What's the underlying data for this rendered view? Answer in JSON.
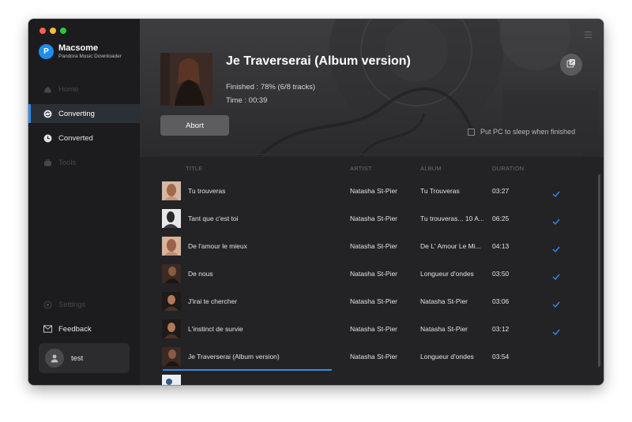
{
  "app": {
    "name": "Macsome",
    "subtitle": "Pandora Music Downloader"
  },
  "sidebar": {
    "items": [
      {
        "label": "Home",
        "icon": "home-icon",
        "state": "disabled"
      },
      {
        "label": "Converting",
        "icon": "converting-icon",
        "state": "active"
      },
      {
        "label": "Converted",
        "icon": "clock-icon",
        "state": "enabled"
      },
      {
        "label": "Tools",
        "icon": "toolbox-icon",
        "state": "disabled"
      }
    ],
    "settings_label": "Settings",
    "feedback_label": "Feedback",
    "user_name": "test"
  },
  "now_converting": {
    "title": "Je Traverserai (Album version)",
    "finished": "Finished : 78% (6/8 tracks)",
    "time": "Time : 00:39",
    "abort_label": "Abort",
    "sleep_label": "Put PC to sleep when finished",
    "sleep_checked": false
  },
  "table": {
    "headers": {
      "title": "TITLE",
      "artist": "ARTIST",
      "album": "ALBUM",
      "duration": "DURATION"
    },
    "rows": [
      {
        "title": "Tu trouveras",
        "artist": "Natasha St-Pier",
        "album": "Tu Trouveras",
        "duration": "03:27",
        "done": true
      },
      {
        "title": "Tant que c'est toi",
        "artist": "Natasha St-Pier",
        "album": "Tu trouveras... 10 A...",
        "duration": "06:25",
        "done": true
      },
      {
        "title": "De l'amour le mieux",
        "artist": "Natasha St-Pier",
        "album": "De L' Amour Le Mi...",
        "duration": "04:13",
        "done": true
      },
      {
        "title": "De nous",
        "artist": "Natasha St-Pier",
        "album": "Longueur d'ondes",
        "duration": "03:50",
        "done": true
      },
      {
        "title": "J'irai te chercher",
        "artist": "Natasha St-Pier",
        "album": "Natasha St-Pier",
        "duration": "03:06",
        "done": true
      },
      {
        "title": "L'instinct de survie",
        "artist": "Natasha St-Pier",
        "album": "Natasha St-Pier",
        "duration": "03:12",
        "done": true
      },
      {
        "title": "Je Traverserai (Album version)",
        "artist": "Natasha St-Pier",
        "album": "Longueur d'ondes",
        "duration": "03:54",
        "done": false,
        "progress": 0.78
      }
    ]
  },
  "colors": {
    "accent": "#2d8df0",
    "sidebar_bg": "#1c1c1e",
    "main_bg": "#232325"
  }
}
